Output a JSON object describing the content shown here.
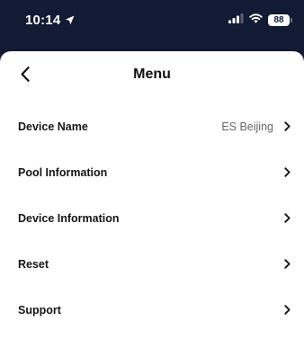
{
  "status_bar": {
    "time": "10:14",
    "battery_level": "88"
  },
  "header": {
    "title": "Menu"
  },
  "menu": {
    "items": [
      {
        "label": "Device Name",
        "value": "ES Beijing"
      },
      {
        "label": "Pool Information",
        "value": ""
      },
      {
        "label": "Device Information",
        "value": ""
      },
      {
        "label": "Reset",
        "value": ""
      },
      {
        "label": "Support",
        "value": ""
      }
    ]
  },
  "colors": {
    "status_bar_bg": "#131a33",
    "sheet_bg": "#ffffff",
    "text_primary": "#151515",
    "text_secondary": "#666666"
  },
  "icons": {
    "location": "location-arrow-icon",
    "signal": "cellular-signal-icon",
    "wifi": "wifi-icon",
    "battery": "battery-icon",
    "back": "chevron-left-icon",
    "row_chevron": "chevron-right-icon"
  }
}
